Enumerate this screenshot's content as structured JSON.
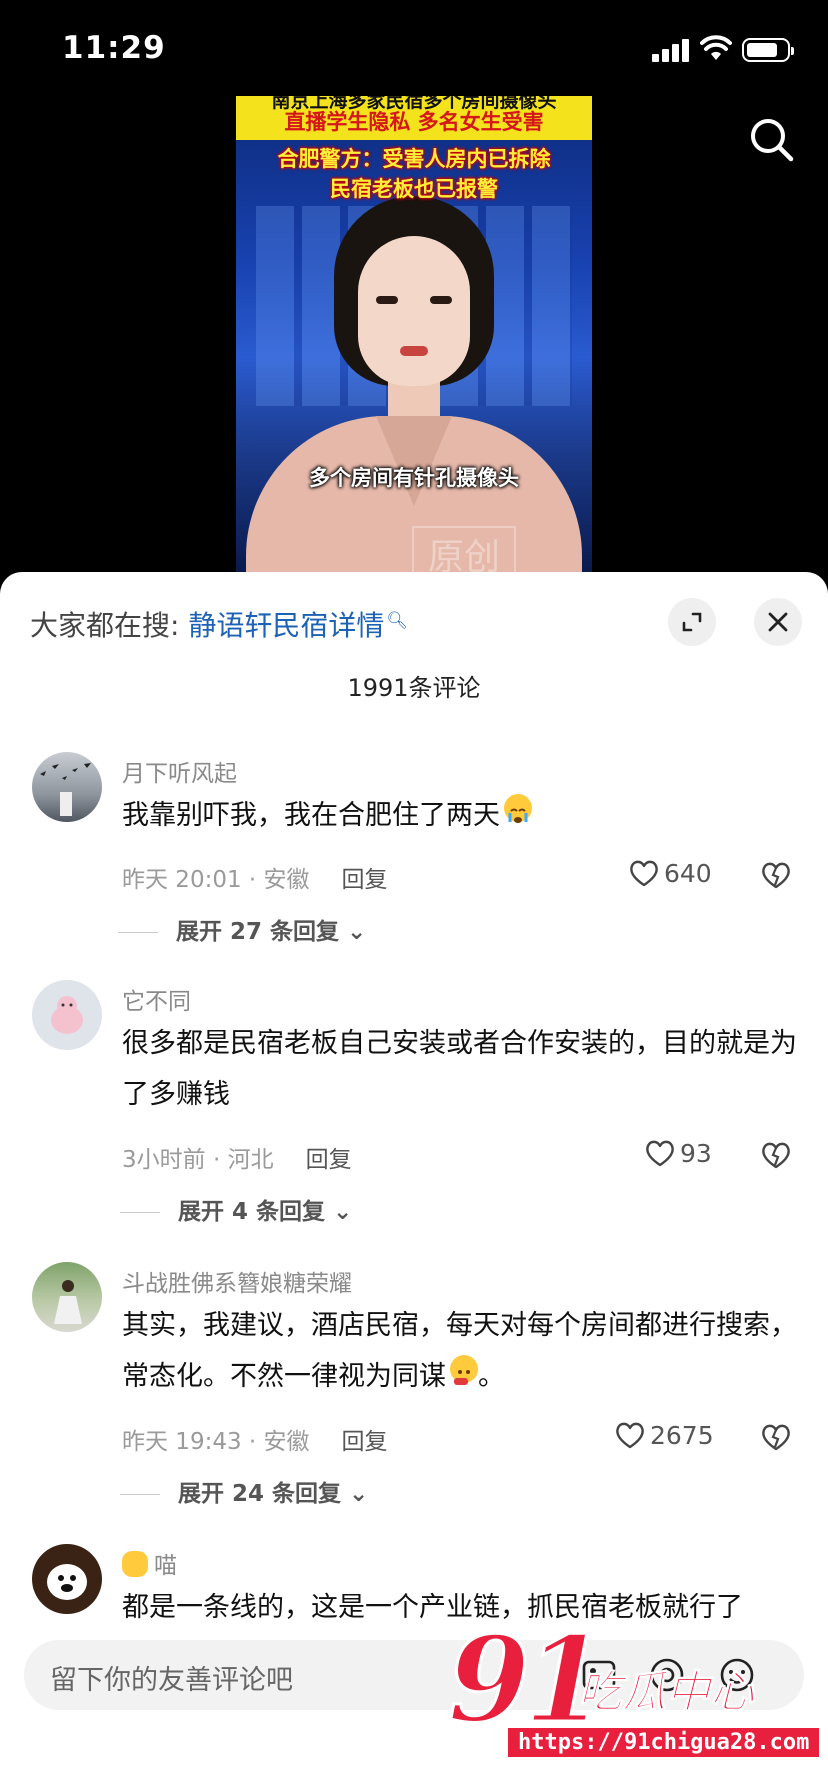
{
  "status_bar": {
    "time": "11:29"
  },
  "video": {
    "banner_top_line1": "南京上海多家民宿多个房间摄像头",
    "banner_top_line2": "直播学生隐私 多名女生受害",
    "banner_red_line1": "合肥警方：受害人房内已拆除",
    "banner_red_line2": "民宿老板也已报警",
    "subtitle": "多个房间有针孔摄像头",
    "watermark": "原创"
  },
  "hot_search": {
    "prefix": "大家都在搜:",
    "keyword": "静语轩民宿详情"
  },
  "comments_count": "1991条评论",
  "comments": [
    {
      "user": "月下听风起",
      "text": "我靠别吓我，我在合肥住了两天",
      "emoji": "crying-face",
      "time_location": "昨天 20:01 · 安徽",
      "reply_label": "回复",
      "likes": "640",
      "expand_label": "展开 27 条回复"
    },
    {
      "user": "它不同",
      "text": "很多都是民宿老板自己安装或者合作安装的，目的就是为了多赚钱",
      "time_location": "3小时前 · 河北",
      "reply_label": "回复",
      "likes": "93",
      "expand_label": "展开 4 条回复"
    },
    {
      "user": "斗战胜佛系簪娘糖荣耀",
      "text": "其实，我建议，酒店民宿，每天对每个房间都进行搜索，常态化。不然一律视为同谋",
      "text_end": "。",
      "emoji": "shush-face",
      "time_location": "昨天 19:43 · 安徽",
      "reply_label": "回复",
      "likes": "2675",
      "expand_label": "展开 24 条回复"
    },
    {
      "user_prefix_emoji": "cat-face",
      "user": "喵",
      "text": "都是一条线的，这是一个产业链，抓民宿老板就行了"
    }
  ],
  "input": {
    "placeholder": "留下你的友善评论吧"
  },
  "watermark": {
    "brand_num": "91",
    "brand_text": "吃瓜中心",
    "url": "https://91chigua28.com"
  }
}
